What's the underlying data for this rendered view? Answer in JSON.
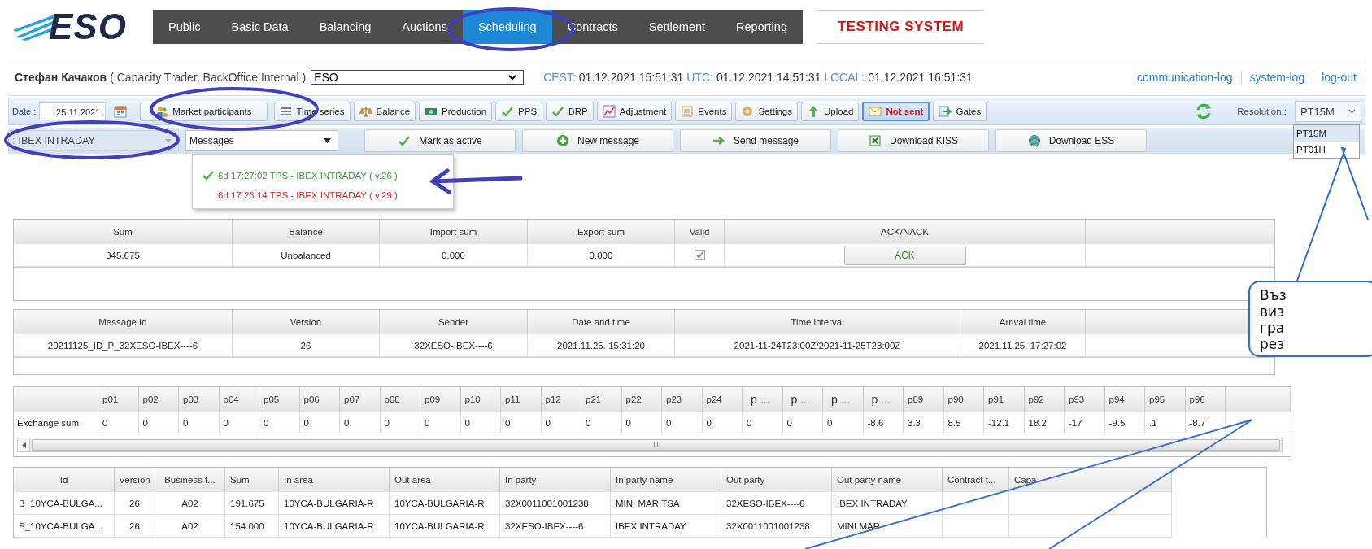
{
  "logo": {
    "text": "ESO"
  },
  "nav": [
    {
      "label": "Public",
      "selected": false
    },
    {
      "label": "Basic Data",
      "selected": false
    },
    {
      "label": "Balancing",
      "selected": false
    },
    {
      "label": "Auctions",
      "selected": false
    },
    {
      "label": "Scheduling",
      "selected": true
    },
    {
      "label": "Contracts",
      "selected": false
    },
    {
      "label": "Settlement",
      "selected": false
    },
    {
      "label": "Reporting",
      "selected": false
    }
  ],
  "testing_label": "TESTING SYSTEM",
  "user": {
    "name": "Стефан Качаков",
    "roles": "( Capacity Trader, BackOffice Internal )",
    "organization": "ESO"
  },
  "clocks": [
    {
      "label": "CEST:",
      "value": "01.12.2021 15:51:31"
    },
    {
      "label": "UTC:",
      "value": "01.12.2021 14:51:31"
    },
    {
      "label": "LOCAL:",
      "value": "01.12.2021 16:51:31"
    }
  ],
  "links": [
    "communication-log",
    "system-log",
    "log-out"
  ],
  "toolbar": {
    "date_label": "Date :",
    "date_value": "25.11.2021",
    "buttons": [
      {
        "label": "Market participants",
        "selected": false
      },
      {
        "label": "Time series",
        "selected": false
      },
      {
        "label": "Balance",
        "selected": false
      },
      {
        "label": "Production",
        "selected": false
      },
      {
        "label": "PPS",
        "selected": false
      },
      {
        "label": "BRP",
        "selected": false
      },
      {
        "label": "Adjustment",
        "selected": false
      },
      {
        "label": "Events",
        "selected": false
      },
      {
        "label": "Settings",
        "selected": false
      },
      {
        "label": "Upload",
        "selected": false
      },
      {
        "label": "Not sent",
        "selected": true
      },
      {
        "label": "Gates",
        "selected": false
      }
    ],
    "resolution_label": "Resolution :",
    "resolution_value": "PT15M",
    "resolution_options": [
      {
        "label": "PT15M",
        "selected": true
      },
      {
        "label": "PT01H",
        "selected": false
      }
    ]
  },
  "action_bar": {
    "combo_prefix": ":",
    "combo_value": "IBEX INTRADAY",
    "messages_value": "Messages",
    "buttons": [
      "Mark as active",
      "New message",
      "Send message",
      "Download KISS",
      "Download ESS"
    ]
  },
  "messages_menu": [
    {
      "text": "6d 17:27:02 TPS - IBEX INTRADAY ( v.26 )",
      "active": true
    },
    {
      "text": "6d 17:26:14 TPS - IBEX INTRADAY ( v.29 )",
      "active": false
    }
  ],
  "summary_table": {
    "columns": [
      "Sum",
      "Balance",
      "Import sum",
      "Export sum",
      "Valid",
      "ACK/NACK"
    ],
    "row": {
      "sum": "345.675",
      "balance": "Unbalanced",
      "import_sum": "0.000",
      "export_sum": "0.000",
      "valid_checked": true,
      "ack": "ACK"
    }
  },
  "message_table": {
    "columns": [
      "Message Id",
      "Version",
      "Sender",
      "Date and time",
      "Time interval",
      "Arrival time"
    ],
    "row": [
      "20211125_ID_P_32XESO-IBEX----6",
      "26",
      "32XESO-IBEX----6",
      "2021.11.25. 15:31:20",
      "2021-11-24T23:00Z/2021-11-25T23:00Z",
      "2021.11.25. 17:27:02"
    ]
  },
  "period_table": {
    "columns": [
      "p01",
      "p02",
      "p03",
      "p04",
      "p05",
      "p06",
      "p07",
      "p08",
      "p09",
      "p10",
      "p11",
      "p12",
      "p21",
      "p22",
      "p23",
      "p24",
      "p ...",
      "p ...",
      "p ...",
      "p ...",
      "p89",
      "p90",
      "p91",
      "p92",
      "p93",
      "p94",
      "p95",
      "p96"
    ],
    "row_label": "Exchange sum",
    "values": [
      "0",
      "0",
      "0",
      "0",
      "0",
      "0",
      "0",
      "0",
      "0",
      "0",
      "0",
      "0",
      "0",
      "0",
      "0",
      "0",
      "0",
      "0",
      "0",
      "-8.6",
      "3.3",
      "8.5",
      "-12.1",
      "18.2",
      "-17",
      "-9.5",
      ".1",
      "-8.7"
    ],
    "scroll_grip": "III"
  },
  "party_table": {
    "columns": [
      "Id",
      "Version",
      "Business t...",
      "Sum",
      "In area",
      "Out area",
      "In party",
      "In party name",
      "Out party",
      "Out party name",
      "Contract t...",
      "Capa"
    ],
    "rows": [
      [
        "B_10YCA-BULGA...",
        "26",
        "A02",
        "191.675",
        "10YCA-BULGARIA-R",
        "10YCA-BULGARIA-R",
        "32X0011001001238",
        "MINI MARITSA",
        "32XESO-IBEX----6",
        "IBEX INTRADAY",
        "",
        ""
      ],
      [
        "S_10YCA-BULGA...",
        "26",
        "A02",
        "154.000",
        "10YCA-BULGARIA-R",
        "10YCA-BULGARIA-R",
        "32XESO-IBEX----6",
        "IBEX INTRADAY",
        "32X0011001001238",
        "MINI MAR",
        "",
        ""
      ]
    ]
  },
  "callout": {
    "lines": [
      "Въз",
      "виз",
      "гра",
      "рез"
    ]
  }
}
